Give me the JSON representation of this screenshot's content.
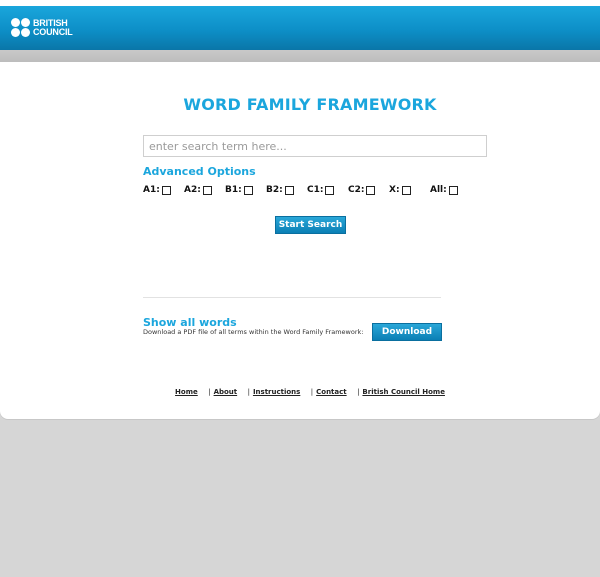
{
  "header": {
    "logo_line1": "BRITISH",
    "logo_line2": "COUNCIL"
  },
  "main": {
    "title": "WORD FAMILY FRAMEWORK",
    "search": {
      "placeholder": "enter search term here...",
      "value": ""
    },
    "advanced_title": "Advanced Options",
    "levels": [
      {
        "label": "A1:",
        "checked": false
      },
      {
        "label": "A2:",
        "checked": false
      },
      {
        "label": "B1:",
        "checked": false
      },
      {
        "label": "B2:",
        "checked": false
      },
      {
        "label": "C1:",
        "checked": false
      },
      {
        "label": "C2:",
        "checked": false
      },
      {
        "label": "X:",
        "checked": false
      },
      {
        "label": "All:",
        "checked": false
      }
    ],
    "start_search_label": "Start Search",
    "show_all_title": "Show all words",
    "show_all_desc": "Download a PDF file of all terms within the Word Family Framework:",
    "download_label": "Download"
  },
  "footer": {
    "links": [
      "Home",
      "About",
      "Instructions",
      "Contact",
      "British Council Home"
    ],
    "separator": "|"
  },
  "colors": {
    "accent": "#1ba6dd",
    "header_blue": "#0d8fc7",
    "background": "#d6d6d6"
  }
}
